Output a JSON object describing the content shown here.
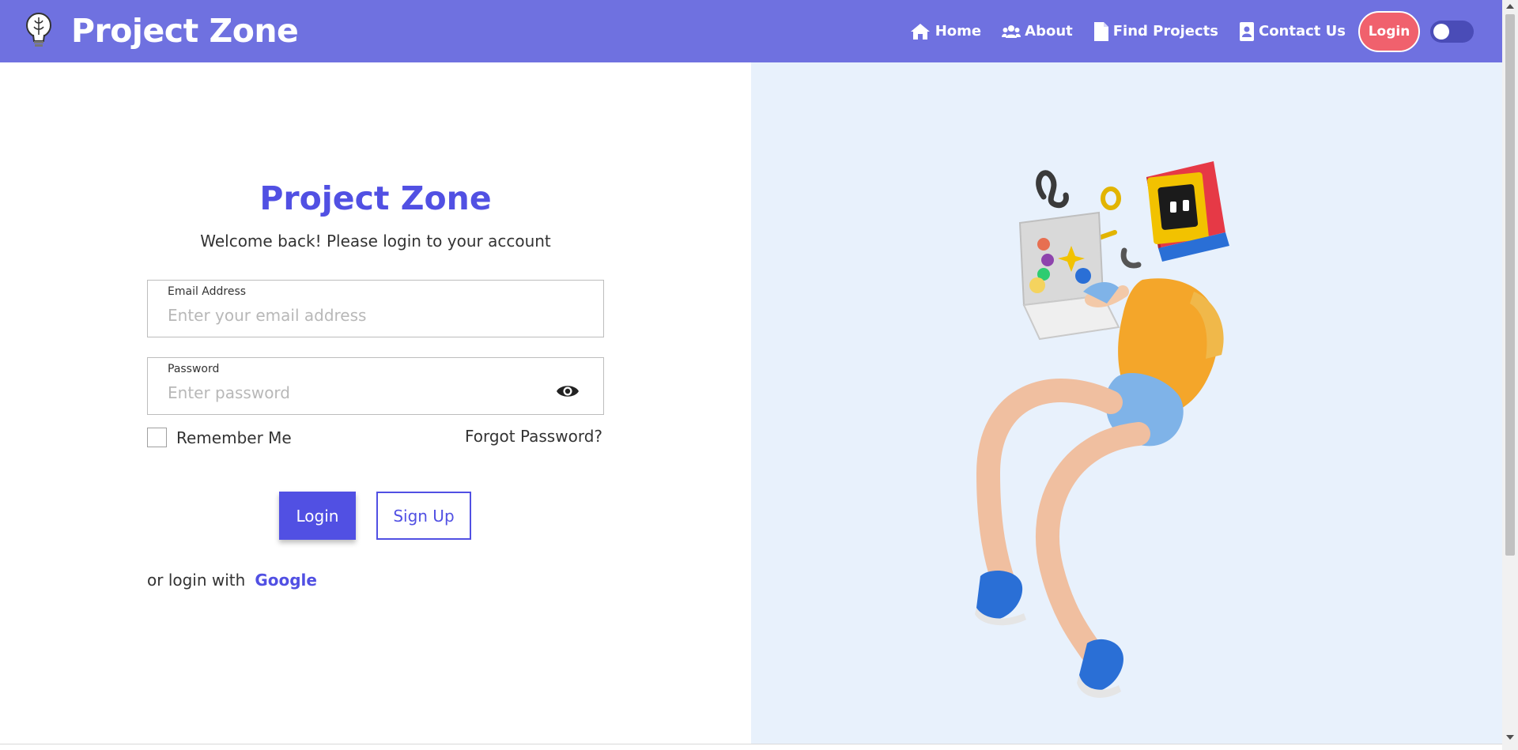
{
  "navbar": {
    "brand": "Project Zone",
    "links": [
      {
        "label": "Home",
        "icon": "home-icon"
      },
      {
        "label": "About",
        "icon": "users-icon"
      },
      {
        "label": "Find Projects",
        "icon": "document-icon"
      },
      {
        "label": "Contact Us",
        "icon": "contact-card-icon"
      }
    ],
    "login_label": "Login",
    "theme_toggle": "off"
  },
  "form": {
    "title": "Project Zone",
    "subtitle": "Welcome back! Please login to your account",
    "email_label": "Email Address",
    "email_placeholder": "Enter your email address",
    "email_value": "",
    "password_label": "Password",
    "password_placeholder": "Enter password",
    "password_value": "",
    "remember_label": "Remember Me",
    "remember_checked": false,
    "forgot_label": "Forgot Password?",
    "login_button": "Login",
    "signup_button": "Sign Up",
    "alt_login_text": "or login with",
    "google_label": "Google"
  },
  "colors": {
    "navbar": "#6f71e0",
    "accent": "#5150e3",
    "login_pill": "#f0616d",
    "illustration_bg": "#e8f1fc"
  },
  "illustration": {
    "icon": "person-with-laptop-illustration"
  }
}
